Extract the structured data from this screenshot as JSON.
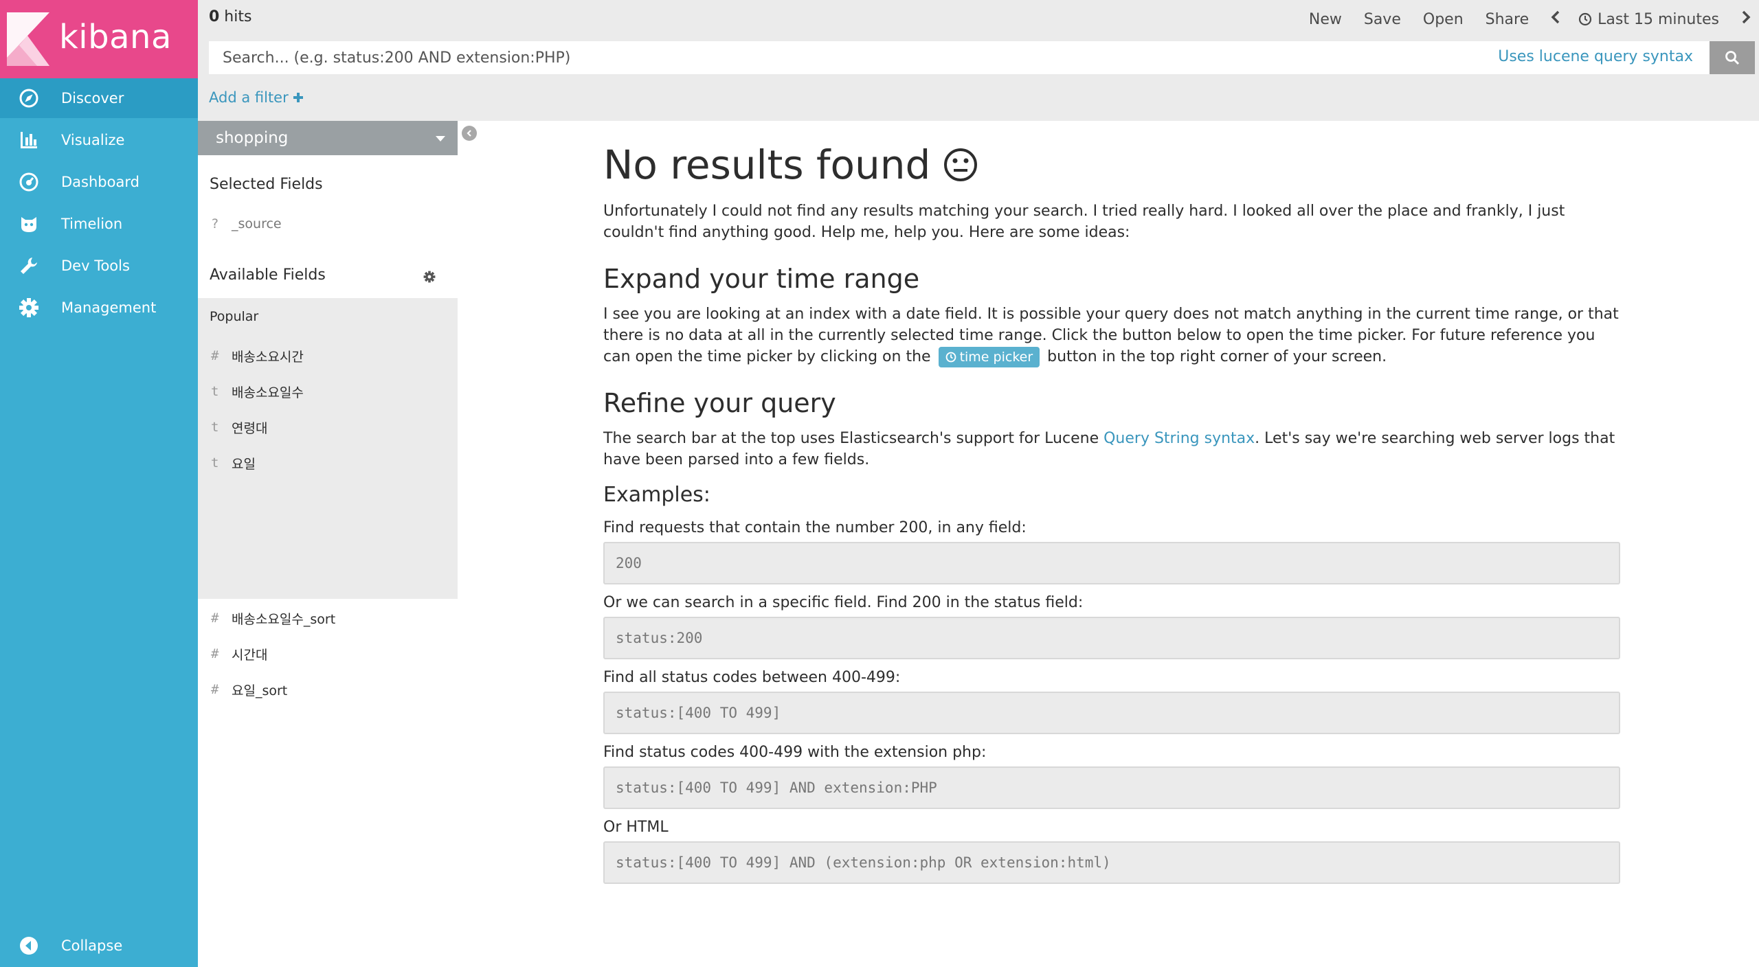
{
  "app": {
    "logo_text": "kibana"
  },
  "nav": {
    "items": [
      {
        "label": "Discover",
        "icon": "compass-icon"
      },
      {
        "label": "Visualize",
        "icon": "bar-chart-icon"
      },
      {
        "label": "Dashboard",
        "icon": "dashboard-icon"
      },
      {
        "label": "Timelion",
        "icon": "timelion-icon"
      },
      {
        "label": "Dev Tools",
        "icon": "wrench-icon"
      },
      {
        "label": "Management",
        "icon": "gear-icon"
      }
    ],
    "collapse_label": "Collapse"
  },
  "topbar": {
    "hits_count": "0",
    "hits_label": " hits",
    "menu": {
      "new": "New",
      "save": "Save",
      "open": "Open",
      "share": "Share",
      "time_range": "Last 15 minutes"
    },
    "search_placeholder": "Search... (e.g. status:200 AND extension:PHP)",
    "lucene_link": "Uses lucene query syntax",
    "add_filter": "Add a filter"
  },
  "sidebar": {
    "index_pattern": "shopping",
    "selected_title": "Selected Fields",
    "selected_fields": [
      {
        "type": "?",
        "name": "_source"
      }
    ],
    "available_title": "Available Fields",
    "popular_title": "Popular",
    "popular_fields": [
      {
        "type": "#",
        "name": "배송소요시간"
      },
      {
        "type": "t",
        "name": "배송소요일수"
      },
      {
        "type": "t",
        "name": "연령대"
      },
      {
        "type": "t",
        "name": "요일"
      }
    ],
    "other_fields": [
      {
        "type": "#",
        "name": "배송소요일수_sort"
      },
      {
        "type": "#",
        "name": "시간대"
      },
      {
        "type": "#",
        "name": "요일_sort"
      }
    ]
  },
  "main": {
    "title": "No results found",
    "intro": "Unfortunately I could not find any results matching your search. I tried really hard. I looked all over the place and frankly, I just couldn't find anything good. Help me, help you. Here are some ideas:",
    "expand_title": "Expand your time range",
    "expand_text_1": "I see you are looking at an index with a date field. It is possible your query does not match anything in the current time range, or that there is no data at all in the currently selected time range. Click the button below to open the time picker. For future reference you can open the time picker by clicking on the",
    "time_picker_label": "time picker",
    "expand_text_2": "button in the top right corner of your screen.",
    "refine_title": "Refine your query",
    "refine_text_1": "The search bar at the top uses Elasticsearch's support for Lucene",
    "refine_link": "Query String syntax",
    "refine_text_2": ". Let's say we're searching web server logs that have been parsed into a few fields.",
    "examples_title": "Examples:",
    "examples": [
      {
        "label": "Find requests that contain the number 200, in any field:",
        "code": "200"
      },
      {
        "label": "Or we can search in a specific field. Find 200 in the status field:",
        "code": "status:200"
      },
      {
        "label": "Find all status codes between 400-499:",
        "code": "status:[400 TO 499]"
      },
      {
        "label": "Find status codes 400-499 with the extension php:",
        "code": "status:[400 TO 499] AND extension:PHP"
      },
      {
        "label": "Or HTML",
        "code": "status:[400 TO 499] AND (extension:php OR extension:html)"
      }
    ]
  }
}
